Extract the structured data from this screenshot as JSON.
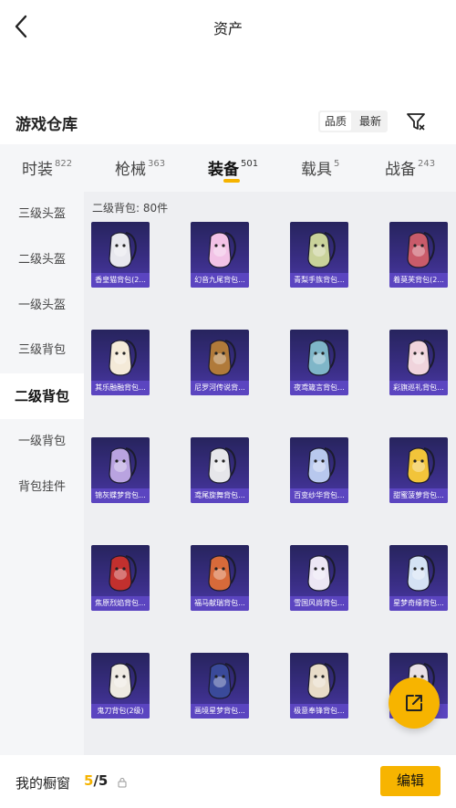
{
  "header": {
    "title": "资产",
    "back_icon": "chevron-left-icon"
  },
  "warehouse": {
    "title": "游戏仓库",
    "sort_options": [
      "品质",
      "最新"
    ],
    "active_sort": "品质",
    "filter_icon": "filter-icon"
  },
  "tabs": [
    {
      "label": "时装",
      "count": "822"
    },
    {
      "label": "枪械",
      "count": "363"
    },
    {
      "label": "装备",
      "count": "501",
      "active": true
    },
    {
      "label": "载具",
      "count": "5"
    },
    {
      "label": "战备",
      "count": "243"
    }
  ],
  "sidebar": {
    "items": [
      "三级头盔",
      "二级头盔",
      "一级头盔",
      "三级背包",
      "二级背包",
      "一级背包",
      "背包挂件"
    ],
    "active": "二级背包"
  },
  "content": {
    "count_label": "二级背包: 80件",
    "items": [
      {
        "name": "香皇猫背包(2...",
        "color": "#e8e8ee"
      },
      {
        "name": "幻音九尾背包...",
        "color": "#f2c2e6"
      },
      {
        "name": "青梨手族背包...",
        "color": "#c9d29a"
      },
      {
        "name": "着莫芙背包(2...",
        "color": "#c95b6a"
      },
      {
        "name": "其乐融融背包...",
        "color": "#f4ead8"
      },
      {
        "name": "尼罗河传说背...",
        "color": "#b07a3a"
      },
      {
        "name": "夜鸢箴言背包...",
        "color": "#7fb6c8"
      },
      {
        "name": "彩旗巡礼背包...",
        "color": "#f0d4dc"
      },
      {
        "name": "锦灰蝶梦背包...",
        "color": "#b9a3e0"
      },
      {
        "name": "鸢尾旋舞背包...",
        "color": "#e6e6ea"
      },
      {
        "name": "百变纱华背包...",
        "color": "#b8c8ee"
      },
      {
        "name": "甜蜜菠萝背包...",
        "color": "#f2c43a"
      },
      {
        "name": "焦原烈焰背包...",
        "color": "#c2302e"
      },
      {
        "name": "福马献瑞背包...",
        "color": "#d76a3a"
      },
      {
        "name": "雪国风尚背包...",
        "color": "#ece6f4"
      },
      {
        "name": "星梦奇缘背包...",
        "color": "#d4e2f4"
      },
      {
        "name": "鬼刀背包(2级)",
        "color": "#eeeae2"
      },
      {
        "name": "画境星梦背包...",
        "color": "#3a4a9a"
      },
      {
        "name": "极意奉锋背包...",
        "color": "#e8dcc8"
      },
      {
        "name": "",
        "color": "#e8e0e6"
      }
    ]
  },
  "fab_icon": "share-external-icon",
  "bottom_bar": {
    "label": "我的橱窗",
    "current": "5",
    "separator": "/",
    "total": "5",
    "lock_icon": "lock-icon",
    "edit_label": "编辑"
  },
  "colors": {
    "accent": "#f7b400",
    "item_card": "#3a2e86",
    "item_label": "#5b45c0"
  }
}
